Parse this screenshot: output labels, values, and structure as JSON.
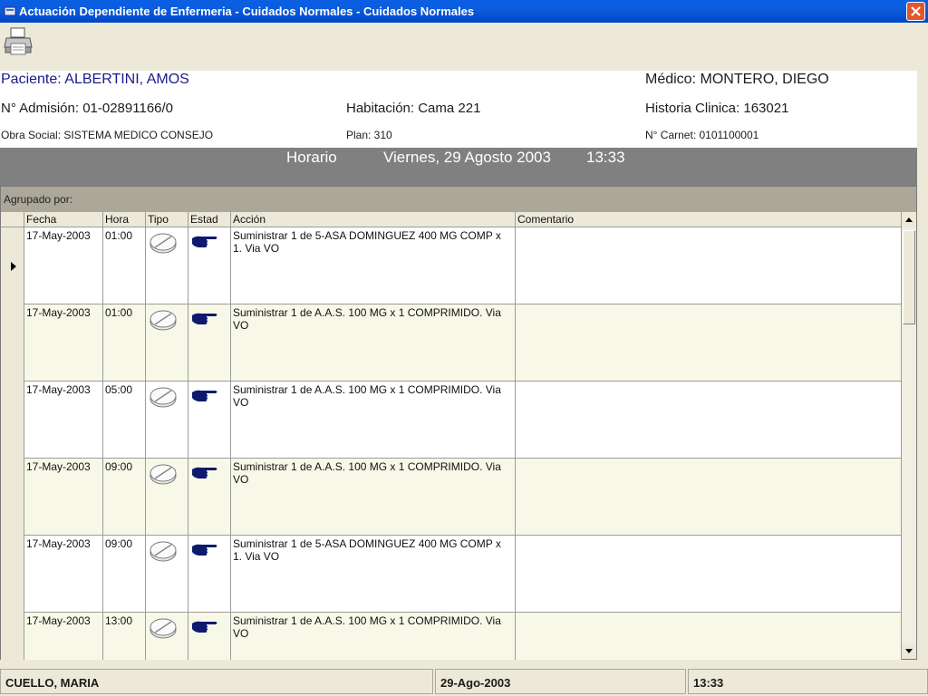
{
  "window": {
    "title": "Actuación Dependiente de Enfermeria - Cuidados Normales - Cuidados Normales"
  },
  "icons": {
    "app": "app-icon",
    "close": "close-icon",
    "print": "printer-icon",
    "type": "pill-icon",
    "status": "pointing-hand-icon"
  },
  "header": {
    "patient_label": "Paciente:",
    "patient_name": "ALBERTINI, AMOS",
    "doctor_label": "Médico:",
    "doctor_name": "MONTERO, DIEGO",
    "admission": "N° Admisión: 01-02891166/0",
    "room": "Habitación: Cama 221",
    "history": "Historia Clinica:  163021",
    "insurance": "Obra Social: SISTEMA MEDICO CONSEJO",
    "plan": "Plan: 310",
    "card": "N° Carnet: 0101100001"
  },
  "schedule": {
    "label": "Horario",
    "date": "Viernes, 29 Agosto 2003",
    "time": "13:33"
  },
  "grid": {
    "group_label": "Agrupado por:",
    "columns": [
      "Fecha",
      "Hora",
      "Tipo",
      "Estad",
      "Acción",
      "Comentario"
    ],
    "rows": [
      {
        "date": "17-May-2003",
        "time": "01:00",
        "action": "Suministrar 1  de 5-ASA DOMINGUEZ 400 MG COMP x 1.  Via VO",
        "comment": ""
      },
      {
        "date": "17-May-2003",
        "time": "01:00",
        "action": "Suministrar 1  de A.A.S. 100 MG x 1 COMPRIMIDO. Via VO",
        "comment": ""
      },
      {
        "date": "17-May-2003",
        "time": "05:00",
        "action": "Suministrar 1  de A.A.S. 100 MG x 1 COMPRIMIDO. Via VO",
        "comment": ""
      },
      {
        "date": "17-May-2003",
        "time": "09:00",
        "action": "Suministrar 1  de A.A.S. 100 MG x 1 COMPRIMIDO. Via VO",
        "comment": ""
      },
      {
        "date": "17-May-2003",
        "time": "09:00",
        "action": "Suministrar 1  de 5-ASA DOMINGUEZ 400 MG COMP x 1.  Via VO",
        "comment": ""
      },
      {
        "date": "17-May-2003",
        "time": "13:00",
        "action": "Suministrar 1  de A.A.S. 100 MG x 1 COMPRIMIDO. Via VO",
        "comment": ""
      }
    ]
  },
  "status": {
    "user": "CUELLO, MARIA",
    "date": "29-Ago-2003",
    "time": "13:33"
  },
  "colors": {
    "title_bar": "#0b5ddc",
    "schedule_bar": "#808080",
    "row_alt": "#f8f8e9",
    "hand_icon": "#0d1a6e"
  }
}
